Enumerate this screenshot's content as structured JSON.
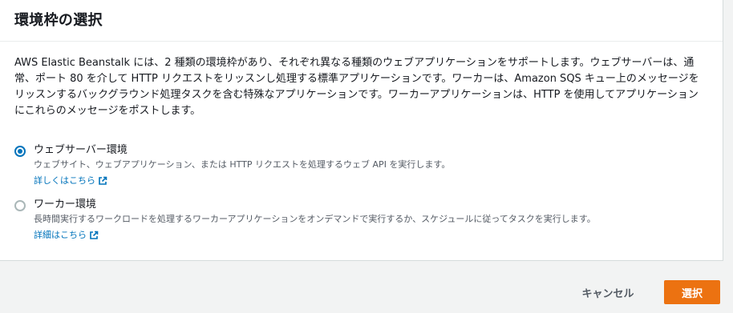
{
  "dialog": {
    "title": "環境枠の選択",
    "description": "AWS Elastic Beanstalk には、2 種類の環境枠があり、それぞれ異なる種類のウェブアプリケーションをサポートします。ウェブサーバーは、通常、ポート 80 を介して HTTP リクエストをリッスンし処理する標準アプリケーションです。ワーカーは、Amazon SQS キュー上のメッセージをリッスンするバックグラウンド処理タスクを含む特殊なアプリケーションです。ワーカーアプリケーションは、HTTP を使用してアプリケーションにこれらのメッセージをポストします。"
  },
  "options": [
    {
      "label": "ウェブサーバー環境",
      "description": "ウェブサイト、ウェブアプリケーション、または HTTP リクエストを処理するウェブ API を実行します。",
      "link": "詳しくはこちら",
      "selected": true
    },
    {
      "label": "ワーカー環境",
      "description": "長時間実行するワークロードを処理するワーカーアプリケーションをオンデマンドで実行するか、スケジュールに従ってタスクを実行します。",
      "link": "詳細はこちら",
      "selected": false
    }
  ],
  "footer": {
    "cancel_label": "キャンセル",
    "select_label": "選択"
  },
  "colors": {
    "accent": "#0073bb",
    "primary_button": "#ec7211"
  },
  "icons": {
    "link": "external-link-icon"
  }
}
